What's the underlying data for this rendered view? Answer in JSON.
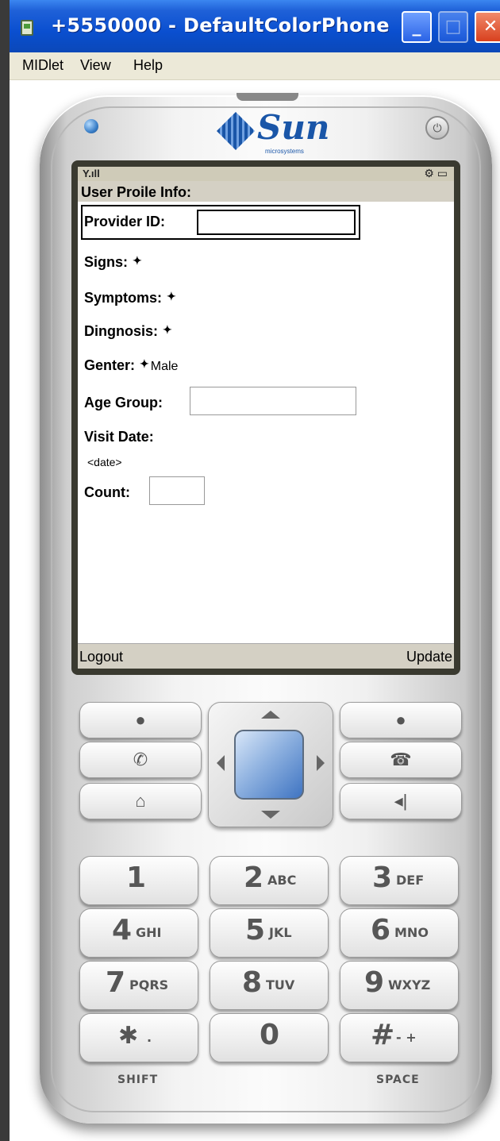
{
  "window": {
    "title": "+5550000 - DefaultColorPhone",
    "buttons": {
      "minimize": "_",
      "maximize": "□",
      "close": "✕"
    }
  },
  "menubar": [
    "MIDlet",
    "View",
    "Help"
  ],
  "phone": {
    "brand": "Sun",
    "brand_sub": "microsystems",
    "screen": {
      "title": "User Proile Info:",
      "fields": {
        "provider_id": {
          "label": "Provider ID:",
          "value": ""
        },
        "signs": {
          "label": "Signs:"
        },
        "symptoms": {
          "label": "Symptoms:"
        },
        "diagnosis": {
          "label": "Dingnosis:"
        },
        "gender": {
          "label": "Genter:",
          "value": "Male"
        },
        "age_group": {
          "label": "Age Group:",
          "value": ""
        },
        "visit_date": {
          "label": "Visit Date:",
          "value": "<date>"
        },
        "count": {
          "label": "Count:",
          "value": ""
        }
      },
      "softkeys": {
        "left": "Logout",
        "right": "Update"
      }
    },
    "keypad": {
      "rows": [
        [
          {
            "digit": "1",
            "letters": ""
          },
          {
            "digit": "2",
            "letters": "ABC"
          },
          {
            "digit": "3",
            "letters": "DEF"
          }
        ],
        [
          {
            "digit": "4",
            "letters": "GHI"
          },
          {
            "digit": "5",
            "letters": "JKL"
          },
          {
            "digit": "6",
            "letters": "MNO"
          }
        ],
        [
          {
            "digit": "7",
            "letters": "PQRS"
          },
          {
            "digit": "8",
            "letters": "TUV"
          },
          {
            "digit": "9",
            "letters": "WXYZ"
          }
        ],
        [
          {
            "digit": "✱",
            "letters": "."
          },
          {
            "digit": "0",
            "letters": ""
          },
          {
            "digit": "#",
            "letters": "- +"
          }
        ]
      ],
      "shift_label": "SHIFT",
      "space_label": "SPACE"
    }
  }
}
